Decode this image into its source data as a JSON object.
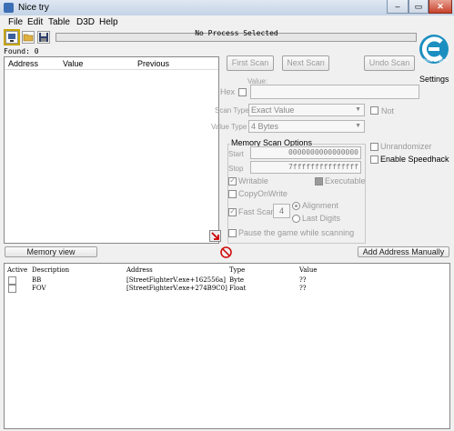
{
  "window": {
    "title": "Nice try",
    "min_symbol": "–",
    "max_symbol": "▭",
    "close_symbol": "✕"
  },
  "menu": {
    "file": "File",
    "edit": "Edit",
    "table": "Table",
    "d3d": "D3D",
    "help": "Help"
  },
  "toolbar": {
    "process_status": "No Process Selected",
    "found_label": "Found: 0",
    "settings_label": "Settings",
    "logo_text": "Cheat Engine"
  },
  "results": {
    "columns": {
      "address": "Address",
      "value": "Value",
      "previous": "Previous"
    }
  },
  "scan": {
    "first_scan": "First Scan",
    "next_scan": "Next Scan",
    "undo_scan": "Undo Scan",
    "value_label": "Value:",
    "hex_label": "Hex",
    "scan_type_label": "Scan Type",
    "scan_type_value": "Exact Value",
    "value_type_label": "Value Type",
    "value_type_value": "4 Bytes",
    "not_label": "Not"
  },
  "memory_options": {
    "title": "Memory Scan Options",
    "start_label": "Start",
    "start_value": "0000000000000000",
    "stop_label": "Stop",
    "stop_value": "7fffffffffffffff",
    "writable": "Writable",
    "executable": "Executable",
    "copy_on_write": "CopyOnWrite",
    "fast_scan": "Fast Scan",
    "fast_scan_value": "4",
    "alignment": "Alignment",
    "last_digits": "Last Digits",
    "pause_game": "Pause the game while scanning"
  },
  "options": {
    "unrandomizer": "Unrandomizer",
    "enable_speedhack": "Enable Speedhack"
  },
  "bottom_buttons": {
    "memory_view": "Memory view",
    "add_address": "Add Address Manually"
  },
  "address_table": {
    "columns": {
      "active": "Active",
      "description": "Description",
      "address": "Address",
      "type": "Type",
      "value": "Value"
    },
    "rows": [
      {
        "description": "BB",
        "address": "[StreetFighterV.exe+162556a]",
        "type": "Byte",
        "value": "??"
      },
      {
        "description": "FOV",
        "address": "[StreetFighterV.exe+274B9C0]",
        "type": "Float",
        "value": "??"
      }
    ]
  }
}
